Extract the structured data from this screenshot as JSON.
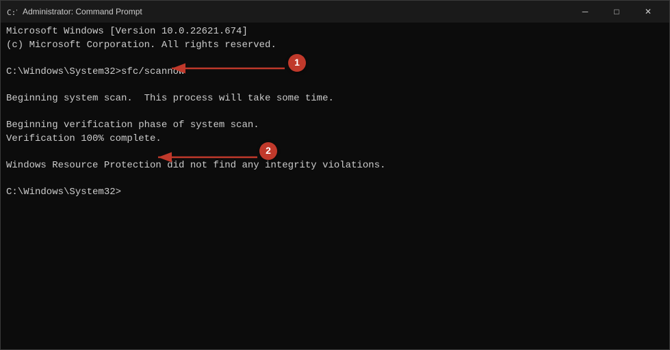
{
  "window": {
    "title": "Administrator: Command Prompt",
    "icon": "cmd-icon"
  },
  "titlebar": {
    "controls": {
      "minimize_label": "─",
      "maximize_label": "□",
      "close_label": "✕"
    }
  },
  "terminal": {
    "lines": [
      "Microsoft Windows [Version 10.0.22621.674]",
      "(c) Microsoft Corporation. All rights reserved.",
      "",
      "C:\\Windows\\System32>sfc/scannow",
      "",
      "Beginning system scan.  This process will take some time.",
      "",
      "Beginning verification phase of system scan.",
      "Verification 100% complete.",
      "",
      "Windows Resource Protection did not find any integrity violations.",
      "",
      "C:\\Windows\\System32>"
    ]
  },
  "annotations": [
    {
      "id": "1",
      "label": "1"
    },
    {
      "id": "2",
      "label": "2"
    }
  ]
}
